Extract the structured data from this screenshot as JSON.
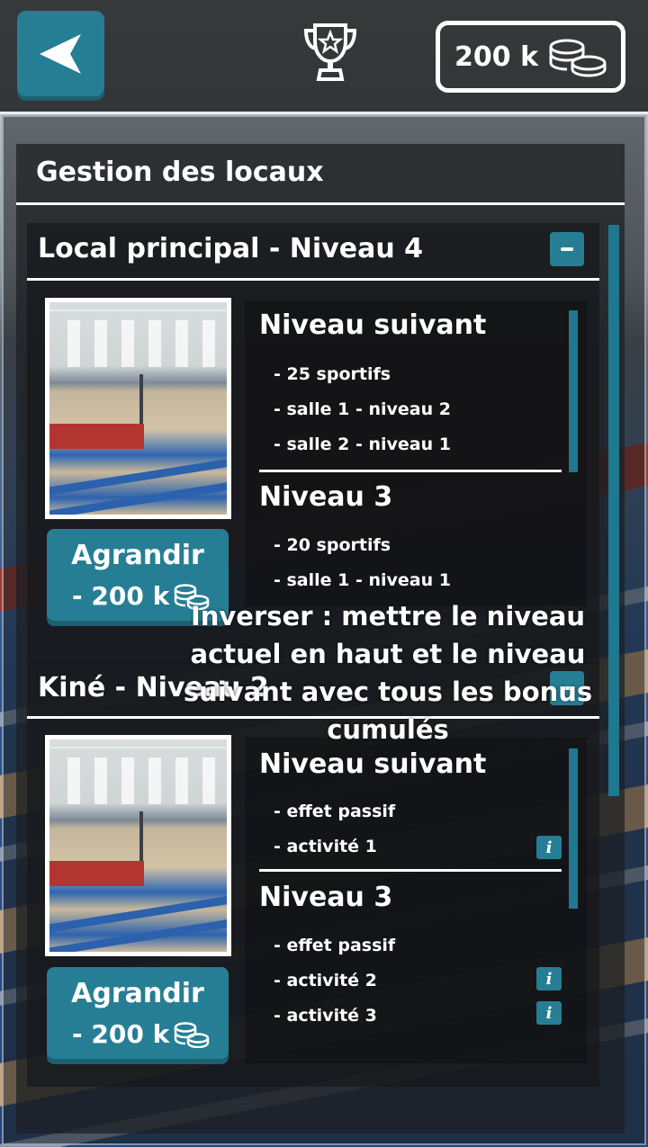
{
  "header": {
    "back_icon": "back-arrow-icon",
    "trophy_icon": "trophy-icon",
    "coins": "200 k",
    "coins_icon": "coins-icon"
  },
  "section": {
    "title": "Gestion des locaux"
  },
  "buildings": [
    {
      "title": "Local principal - Niveau 4",
      "collapse_icon": "minus-icon",
      "upgrade_label": "Agrandir",
      "upgrade_cost": "- 200 k",
      "levels": [
        {
          "title": "Niveau suivant",
          "items": [
            "- 25 sportifs",
            "- salle 1 - niveau 2",
            "- salle 2 - niveau 1"
          ]
        },
        {
          "title": "Niveau 3",
          "items": [
            "- 20 sportifs",
            "- salle 1 - niveau 1"
          ]
        }
      ]
    },
    {
      "title": "Kiné - Niveau 2",
      "collapse_icon": "minus-icon",
      "upgrade_label": "Agrandir",
      "upgrade_cost": "- 200 k",
      "levels": [
        {
          "title": "Niveau suivant",
          "items": [
            "- effet passif",
            "- activité 1"
          ]
        },
        {
          "title": "Niveau 3",
          "items": [
            "- effet passif",
            "- activité 2",
            "- activité 3"
          ]
        }
      ]
    }
  ],
  "note": "Inverser : mettre le niveau actuel en haut et le niveau suivant avec tous les bonus cumulés",
  "colors": {
    "accent": "#267e94",
    "accent_dark": "#1c5f70",
    "panel": "#1c1e21"
  }
}
